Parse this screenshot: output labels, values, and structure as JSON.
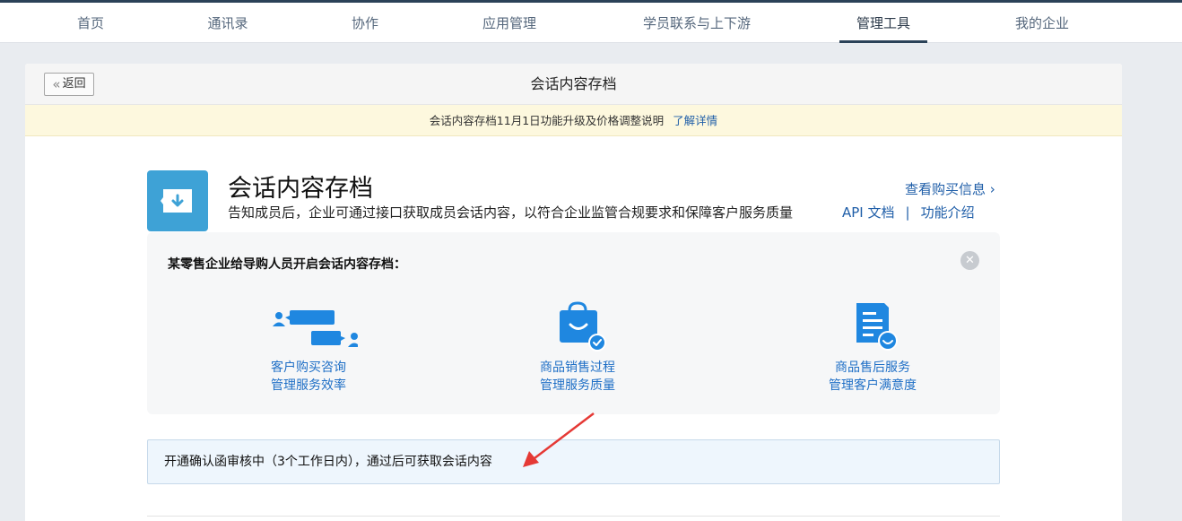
{
  "nav": {
    "items": [
      {
        "label": "首页"
      },
      {
        "label": "通讯录"
      },
      {
        "label": "协作"
      },
      {
        "label": "应用管理"
      },
      {
        "label": "学员联系与上下游"
      },
      {
        "label": "管理工具"
      },
      {
        "label": "我的企业"
      }
    ],
    "active": "管理工具"
  },
  "header": {
    "back_label": "返回",
    "title": "会话内容存档"
  },
  "notice": {
    "text": "会话内容存档11月1日功能升级及价格调整说明",
    "link": "了解详情"
  },
  "app": {
    "icon": "archive-download-icon",
    "title": "会话内容存档",
    "description": "告知成员后，企业可通过接口获取成员会话内容，以符合企业监管合规要求和保障客户服务质量",
    "buy_link": "查看购买信息",
    "api_link": "API 文档",
    "separator": "|",
    "intro_link": "功能介绍"
  },
  "example": {
    "title": "某零售企业给导购人员开启会话内容存档：",
    "features": [
      {
        "icon": "chat-users-icon",
        "line1": "客户购买咨询",
        "line2": "管理服务效率"
      },
      {
        "icon": "shopping-bag-check-icon",
        "line1": "商品销售过程",
        "line2": "管理服务质量"
      },
      {
        "icon": "document-smile-icon",
        "line1": "商品售后服务",
        "line2": "管理客户满意度"
      }
    ]
  },
  "status": {
    "text": "开通确认函审核中（3个工作日内），通过后可获取会话内容"
  },
  "colors": {
    "accent": "#1f6fc6",
    "link": "#1f5ea8",
    "app_icon_bg": "#3ea2d6",
    "annotation_arrow": "#e53935"
  }
}
